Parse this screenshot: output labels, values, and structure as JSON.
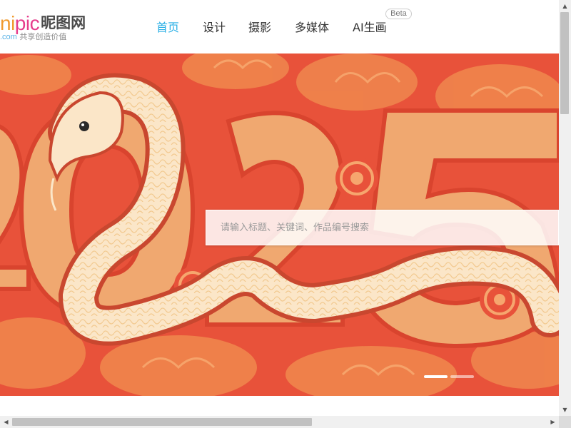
{
  "logo": {
    "latin_prefix": "ni",
    "latin_accent": "pic",
    "name_cn": "昵图网",
    "domain_suffix": ".com",
    "tagline": "共享创造价值"
  },
  "nav": {
    "items": [
      {
        "label": "首页",
        "active": true
      },
      {
        "label": "设计",
        "active": false
      },
      {
        "label": "摄影",
        "active": false
      },
      {
        "label": "多媒体",
        "active": false
      },
      {
        "label": "AI生画",
        "active": false
      }
    ],
    "beta_badge": "Beta"
  },
  "banner": {
    "theme_year": "2025",
    "search": {
      "placeholder": "请输入标题、关键词、作品编号搜索",
      "value": ""
    },
    "carousel": {
      "slide_count": 2,
      "active_index": 0
    }
  },
  "colors": {
    "accent": "#26aee5",
    "banner_background": "#e8523a",
    "numeral_fill": "#f0a870",
    "snake": "#fbe6c8",
    "text": "#333333"
  },
  "scrollbars": {
    "vertical": {
      "position_fraction": 0.0,
      "visible_fraction": 0.25
    },
    "horizontal": {
      "position_fraction": 0.0,
      "visible_fraction": 0.55
    }
  },
  "icons": {
    "scroll_up": "up-arrow-icon",
    "scroll_down": "down-arrow-icon",
    "scroll_left": "left-arrow-icon",
    "scroll_right": "right-arrow-icon"
  }
}
